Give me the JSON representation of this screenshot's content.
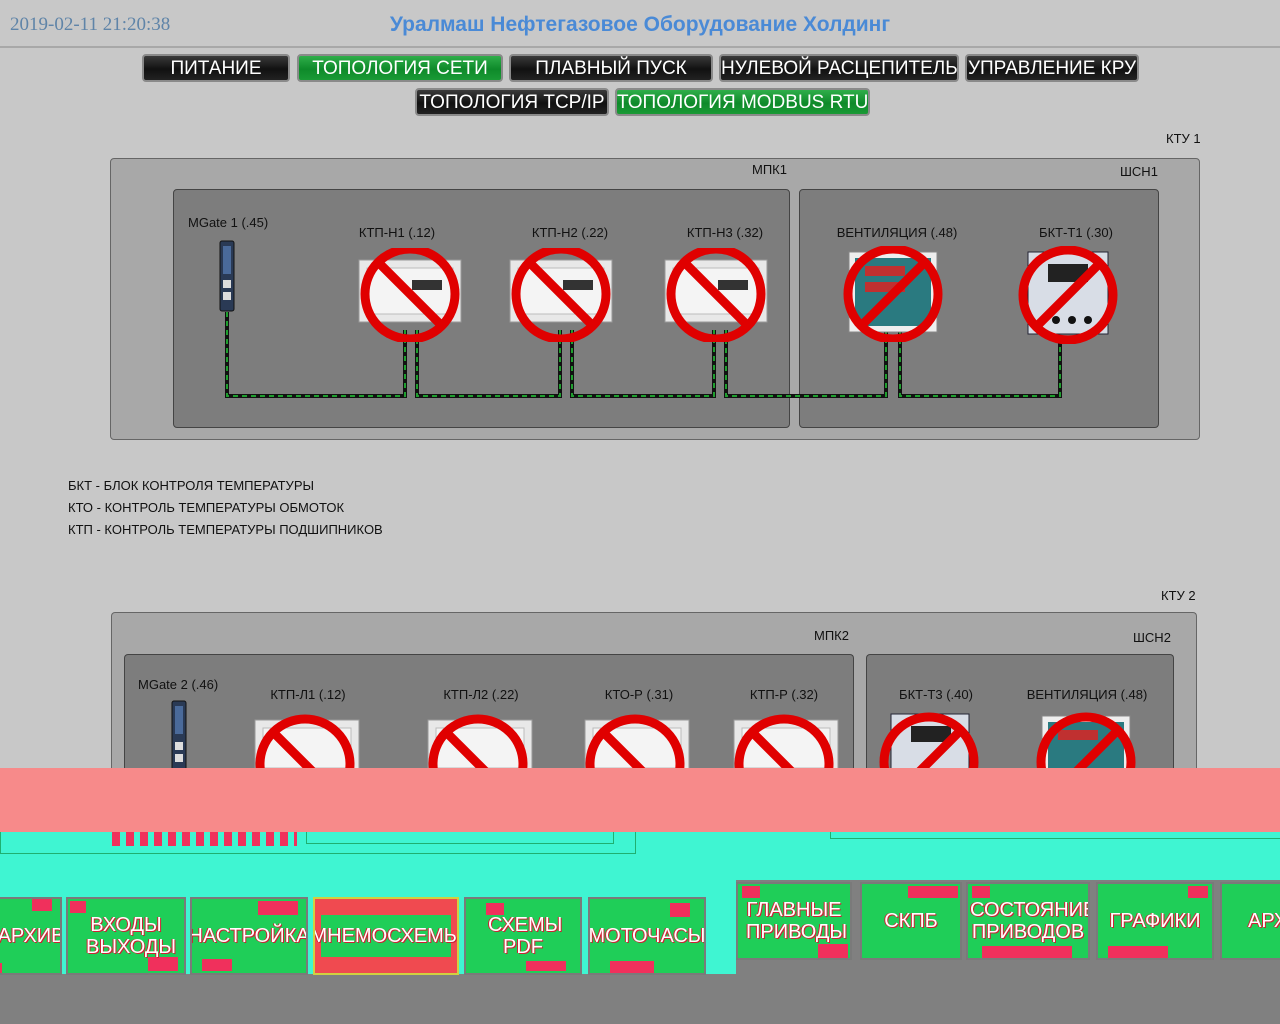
{
  "header": {
    "datetime": "2019-02-11 21:20:38",
    "company": "Уралмаш Нефтегазовое Оборудование Холдинг"
  },
  "nav": {
    "row1": [
      {
        "label": "ПИТАНИЕ",
        "active": false
      },
      {
        "label": "ТОПОЛОГИЯ СЕТИ",
        "active": true
      },
      {
        "label": "ПЛАВНЫЙ ПУСК",
        "active": false
      },
      {
        "label": "НУЛЕВОЙ РАСЦЕПИТЕЛЬ",
        "active": false
      },
      {
        "label": "УПРАВЛЕНИЕ КРУ",
        "active": false
      }
    ],
    "row2": [
      {
        "label": "ТОПОЛОГИЯ TCP/IP",
        "active": false
      },
      {
        "label": "ТОПОЛОГИЯ MODBUS RTU",
        "active": true
      }
    ]
  },
  "ktu1": {
    "title": "КТУ 1",
    "mpk": "МПК1",
    "shsn": "ШСН1",
    "gateway": "MGate 1 (.45)",
    "devices": [
      "КТП-Н1 (.12)",
      "КТП-Н2 (.22)",
      "КТП-Н3 (.32)",
      "ВЕНТИЛЯЦИЯ (.48)",
      "БКТ-Т1 (.30)"
    ]
  },
  "legend": [
    "БКТ - БЛОК КОНТРОЛЯ ТЕМПЕРАТУРЫ",
    "КТО - КОНТРОЛЬ ТЕМПЕРАТУРЫ ОБМОТОК",
    "КТП - КОНТРОЛЬ ТЕМПЕРАТУРЫ ПОДШИПНИКОВ"
  ],
  "ktu2": {
    "title": "КТУ 2",
    "mpk": "МПК2",
    "shsn": "ШСН2",
    "gateway": "MGate 2 (.46)",
    "devices": [
      "КТП-Л1 (.12)",
      "КТП-Л2 (.22)",
      "КТО-Р (.31)",
      "КТП-Р (.32)",
      "БКТ-Т3 (.40)",
      "ВЕНТИЛЯЦИЯ (.48)"
    ]
  },
  "bottom_nav": [
    {
      "label": "АРХИВ",
      "active": false
    },
    {
      "label": "ВХОДЫ ВЫХОДЫ",
      "active": false
    },
    {
      "label": "НАСТРОЙКА",
      "active": false
    },
    {
      "label": "МНЕМОСХЕМЫ",
      "active": true
    },
    {
      "label": "СХЕМЫ PDF",
      "active": false
    },
    {
      "label": "МОТОЧАСЫ",
      "active": false
    },
    {
      "label": "ГЛАВНЫЕ ПРИВОДЫ",
      "active": false
    },
    {
      "label": "СКПБ",
      "active": false
    },
    {
      "label": "СОСТОЯНИЕ ПРИВОДОВ",
      "active": false
    },
    {
      "label": "ГРАФИКИ",
      "active": false
    },
    {
      "label": "АРХИВ",
      "active": false
    }
  ],
  "colors": {
    "accent_title": "#4a8ad6",
    "nav_active": "#0e8a2a",
    "nav_inactive": "#111111",
    "fault_red": "#e00000",
    "bus_line": "#1e9e2e"
  }
}
